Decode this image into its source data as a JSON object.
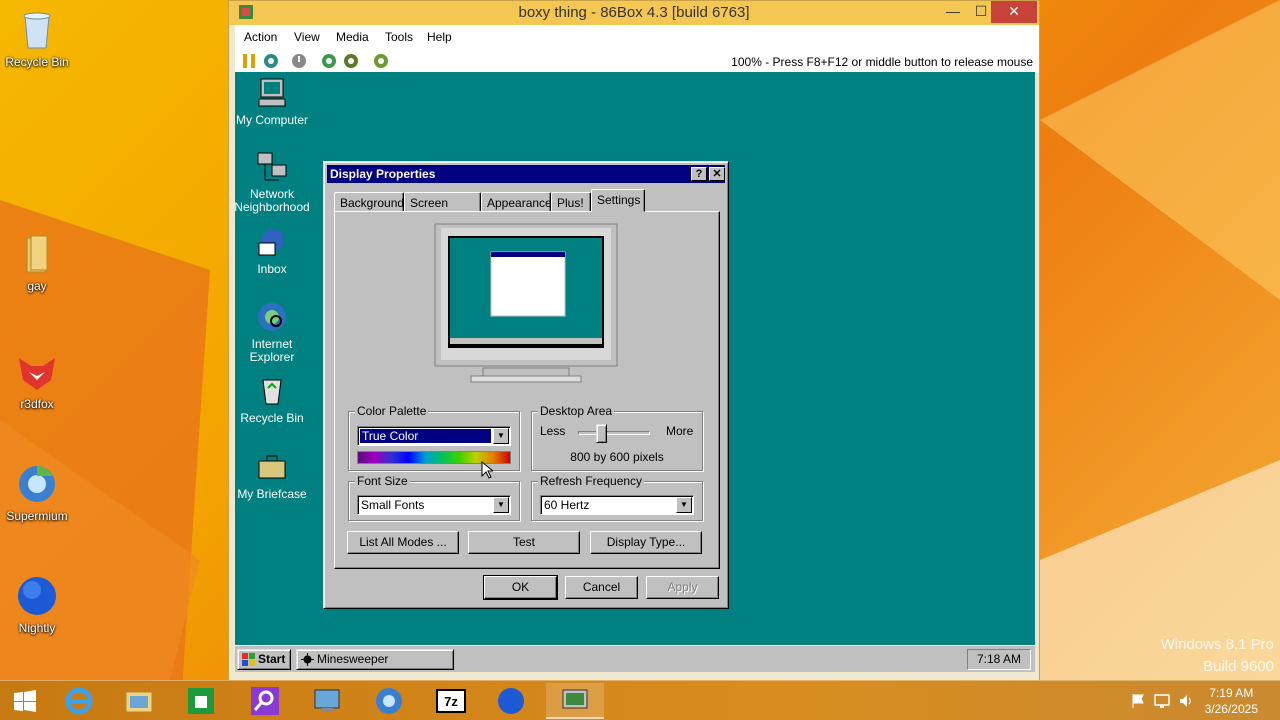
{
  "host": {
    "desktop_icons": [
      {
        "label": "Recycle Bin"
      },
      {
        "label": "gay"
      },
      {
        "label": "r3dfox"
      },
      {
        "label": "Supermium"
      },
      {
        "label": "Nightly"
      }
    ],
    "watermark": {
      "line1": "Windows 8.1 Pro",
      "line2": "Build 9600"
    },
    "clock": {
      "time": "7:19 AM",
      "date": "3/26/2025"
    }
  },
  "vm": {
    "title": "boxy thing - 86Box 4.3 [build 6763]",
    "menus": [
      "Action",
      "View",
      "Media",
      "Tools",
      "Help"
    ],
    "status": "100% - Press F8+F12 or middle button to release mouse"
  },
  "guest": {
    "icons": [
      {
        "label": "My Computer"
      },
      {
        "label": "Network Neighborhood"
      },
      {
        "label": "Inbox"
      },
      {
        "label": "Internet Explorer"
      },
      {
        "label": "Recycle Bin"
      },
      {
        "label": "My Briefcase"
      }
    ],
    "dialog": {
      "title": "Display Properties",
      "tabs": [
        "Background",
        "Screen Saver",
        "Appearance",
        "Plus!",
        "Settings"
      ],
      "active_tab": "Settings",
      "color_palette": {
        "label": "Color Palette",
        "value": "True Color"
      },
      "desktop_area": {
        "label": "Desktop Area",
        "less": "Less",
        "more": "More",
        "value": "800 by 600 pixels",
        "slider_position": 0.3
      },
      "font_size": {
        "label": "Font Size",
        "value": "Small Fonts"
      },
      "refresh": {
        "label": "Refresh Frequency",
        "value": "60 Hertz"
      },
      "buttons": {
        "list_modes": "List All Modes ...",
        "test": "Test",
        "display_type": "Display Type...",
        "ok": "OK",
        "cancel": "Cancel",
        "apply": "Apply"
      },
      "title_help": "?",
      "title_close": "✕"
    },
    "taskbar": {
      "start": "Start",
      "task": "Minesweeper",
      "clock": "7:18 AM"
    }
  },
  "colors": {
    "guest_desktop": "#008080",
    "win95_face": "#c0c0c0",
    "title_blue": "#000080",
    "vm_titlebar": "#f4c752"
  }
}
